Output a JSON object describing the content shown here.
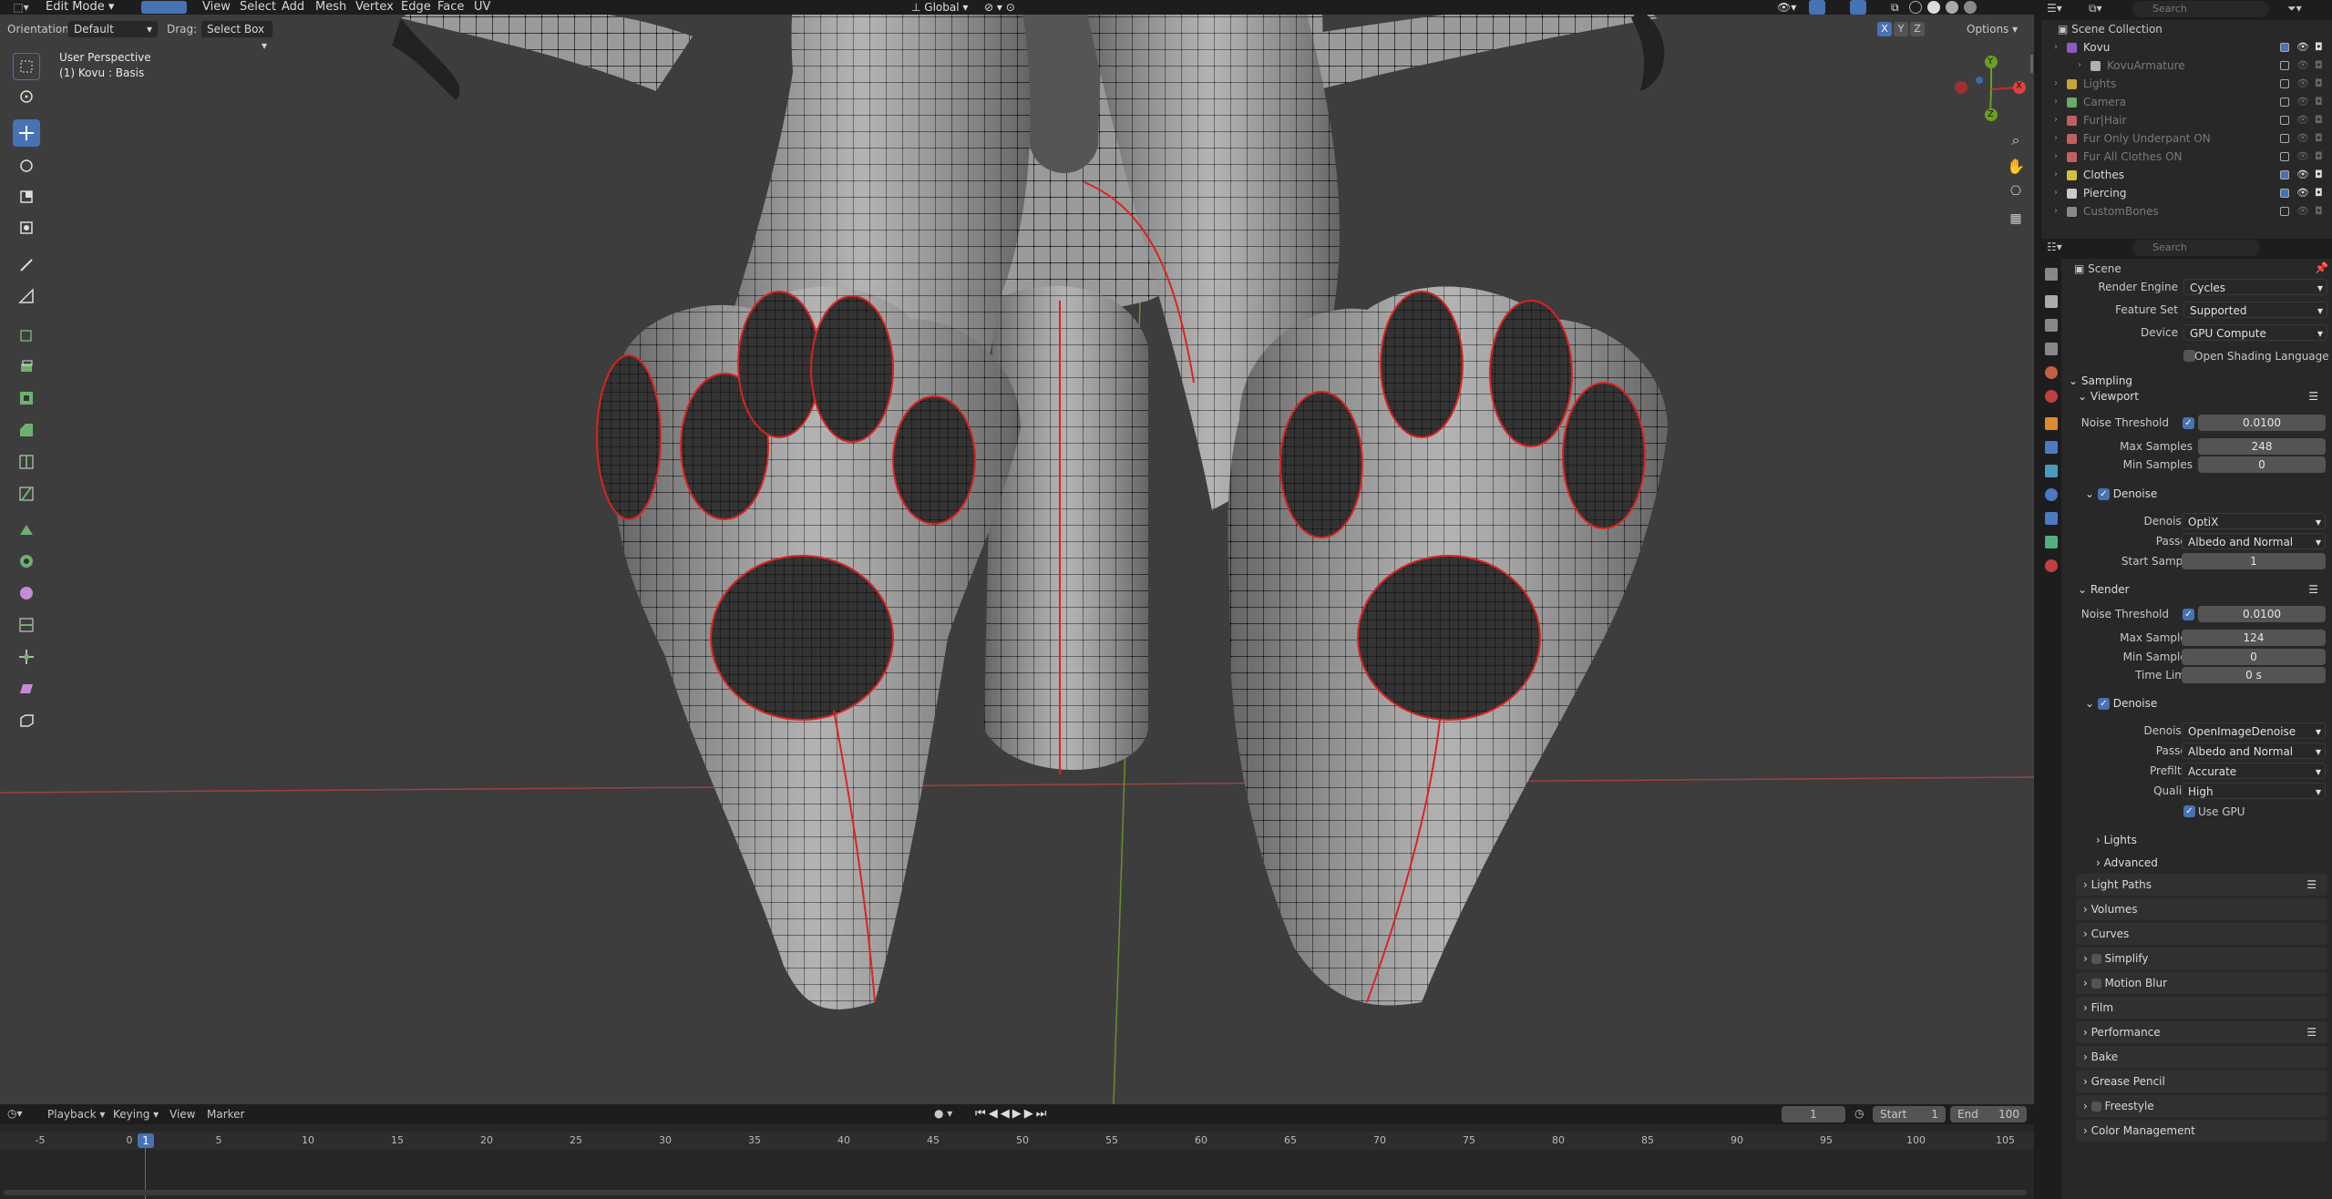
{
  "header": {
    "mode": "Edit Mode",
    "menus": [
      "View",
      "Select",
      "Add",
      "Mesh",
      "Vertex",
      "Edge",
      "Face",
      "UV"
    ],
    "transform_orientation": "Global",
    "search_placeholder": "Search"
  },
  "header2": {
    "orientation_label": "Orientation:",
    "orientation_value": "Default",
    "drag_label": "Drag:",
    "drag_value": "Select Box",
    "options": "Options"
  },
  "viewport": {
    "perspective": "User Perspective",
    "object": "(1) Kovu : Basis",
    "gizmo": {
      "x": "X",
      "y": "Y",
      "z": "Z"
    }
  },
  "timeline": {
    "menus": [
      "Playback",
      "Keying",
      "View",
      "Marker"
    ],
    "current_frame": "1",
    "start_label": "Start",
    "start": "1",
    "end_label": "End",
    "end": "100",
    "ticks": [
      "-5",
      "0",
      "5",
      "10",
      "15",
      "20",
      "25",
      "30",
      "35",
      "40",
      "45",
      "50",
      "55",
      "60",
      "65",
      "70",
      "75",
      "80",
      "85",
      "90",
      "95",
      "100",
      "105"
    ],
    "playhead": "1"
  },
  "outliner": {
    "search_placeholder": "Search",
    "root": "Scene Collection",
    "items": [
      {
        "label": "Kovu",
        "indent": 1,
        "color": "#8a5cc0",
        "active": true
      },
      {
        "label": "KovuArmature",
        "indent": 2,
        "color": "#b0b0b0",
        "active": false
      },
      {
        "label": "Lights",
        "indent": 1,
        "color": "#c9a23a",
        "active": false
      },
      {
        "label": "Camera",
        "indent": 1,
        "color": "#6ca86c",
        "active": false
      },
      {
        "label": "Fur|Hair",
        "indent": 1,
        "color": "#c06060",
        "active": false
      },
      {
        "label": "Fur Only Underpant ON",
        "indent": 1,
        "color": "#c06060",
        "active": false
      },
      {
        "label": "Fur All Clothes ON",
        "indent": 1,
        "color": "#c06060",
        "active": false
      },
      {
        "label": "Clothes",
        "indent": 1,
        "color": "#d0c040",
        "active": true
      },
      {
        "label": "Piercing",
        "indent": 1,
        "color": "#c9c9c9",
        "active": true
      },
      {
        "label": "CustomBones",
        "indent": 1,
        "color": "#888",
        "active": false
      }
    ]
  },
  "properties": {
    "search_placeholder": "Search",
    "context": "Scene",
    "render_engine_label": "Render Engine",
    "render_engine": "Cycles",
    "feature_set_label": "Feature Set",
    "feature_set": "Supported",
    "device_label": "Device",
    "device": "GPU Compute",
    "osl": "Open Shading Language",
    "sampling": "Sampling",
    "viewport": {
      "title": "Viewport",
      "noise_threshold_label": "Noise Threshold",
      "noise_threshold": "0.0100",
      "max_samples_label": "Max Samples",
      "max_samples": "248",
      "min_samples_label": "Min Samples",
      "min_samples": "0",
      "denoise": "Denoise",
      "denoiser_label": "Denoiser",
      "denoiser": "OptiX",
      "passes_label": "Passes",
      "passes": "Albedo and Normal",
      "start_sample_label": "Start Sample",
      "start_sample": "1"
    },
    "render": {
      "title": "Render",
      "noise_threshold_label": "Noise Threshold",
      "noise_threshold": "0.0100",
      "max_samples_label": "Max Samples",
      "max_samples": "124",
      "min_samples_label": "Min Samples",
      "min_samples": "0",
      "time_limit_label": "Time Limit",
      "time_limit": "0 s",
      "denoise": "Denoise",
      "denoiser_label": "Denoiser",
      "denoiser": "OpenImageDenoise",
      "passes_label": "Passes",
      "passes": "Albedo and Normal",
      "prefilter_label": "Prefilter",
      "prefilter": "Accurate",
      "quality_label": "Quality",
      "quality": "High",
      "use_gpu": "Use GPU"
    },
    "subpanels": [
      "Lights",
      "Advanced"
    ],
    "panels": [
      "Light Paths",
      "Volumes",
      "Curves",
      "Simplify",
      "Motion Blur",
      "Film",
      "Performance",
      "Bake",
      "Grease Pencil",
      "Freestyle",
      "Color Management"
    ]
  }
}
